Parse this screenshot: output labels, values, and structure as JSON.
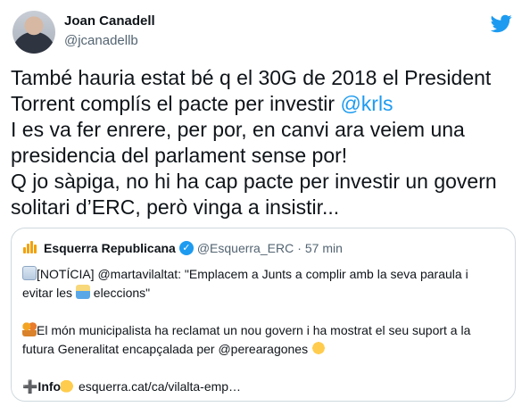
{
  "author": {
    "name": "Joan Canadell",
    "handle": "@jcanadellb"
  },
  "tweet": {
    "text_before_mention": "També hauria estat bé q el 30G de 2018 el President\nTorrent complís el pacte per investir ",
    "mention": "@krls",
    "text_after_mention": "\nI es va fer enrere, per por, en canvi ara veiem una\npresidencia del parlament sense por!\nQ jo sàpiga, no hi ha cap pacte per investir un govern\nsolitari d’ERC, però vinga a insistir..."
  },
  "quote": {
    "name": "Esquerra Republicana",
    "handle": "@Esquerra_ERC",
    "separator": "·",
    "time": "57 min",
    "line1": "[NOTÍCIA] @martavilaltat: \"Emplacem a Junts a complir amb la seva paraula i",
    "line2_a": "evitar les ",
    "line2_b": " eleccions\"",
    "line3": "El món municipalista ha reclamat un nou govern i ha mostrat el seu suport a la",
    "line4": "futura Generalitat encapçalada per @perearagones ",
    "line5_a": "➕Info",
    "line5_b": " esquerra.cat/ca/vilalta-emp…"
  },
  "colors": {
    "accent": "#1d9bf0",
    "muted": "#536471",
    "border": "#cfd9de",
    "erc": "#f2a20c"
  },
  "icons": [
    "twitter-bird-icon",
    "verified-badge-icon",
    "erc-logo-icon",
    "newspaper-emoji",
    "ballot-box-emoji",
    "people-emoji",
    "raised-fist-emoji",
    "pointing-hand-emoji"
  ]
}
